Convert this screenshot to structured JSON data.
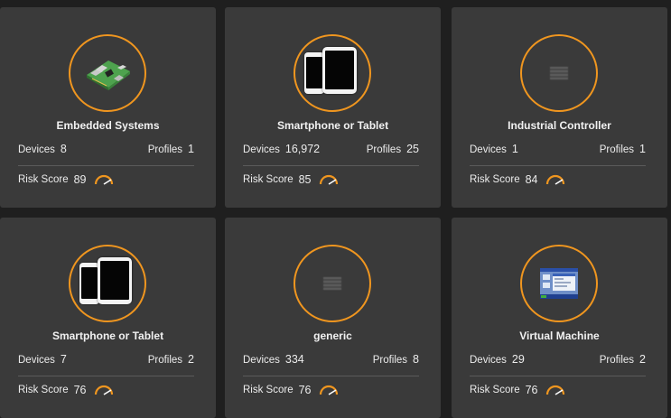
{
  "labels": {
    "devices": "Devices",
    "profiles": "Profiles",
    "risk_score": "Risk Score"
  },
  "accent_color": "#f0961f",
  "cards": [
    {
      "title": "Embedded Systems",
      "icon": "raspberry-pi-board-icon",
      "devices": "8",
      "profiles": "1",
      "risk": "89"
    },
    {
      "title": "Smartphone or Tablet",
      "icon": "phone-tablet-icon",
      "devices": "16,972",
      "profiles": "25",
      "risk": "85"
    },
    {
      "title": "Industrial Controller",
      "icon": "generic-chip-icon",
      "devices": "1",
      "profiles": "1",
      "risk": "84"
    },
    {
      "title": "Smartphone or Tablet",
      "icon": "phone-tablet-icon",
      "devices": "7",
      "profiles": "2",
      "risk": "76"
    },
    {
      "title": "generic",
      "icon": "generic-chip-icon",
      "devices": "334",
      "profiles": "8",
      "risk": "76"
    },
    {
      "title": "Virtual Machine",
      "icon": "virtual-machine-desktop-icon",
      "devices": "29",
      "profiles": "2",
      "risk": "76"
    }
  ]
}
